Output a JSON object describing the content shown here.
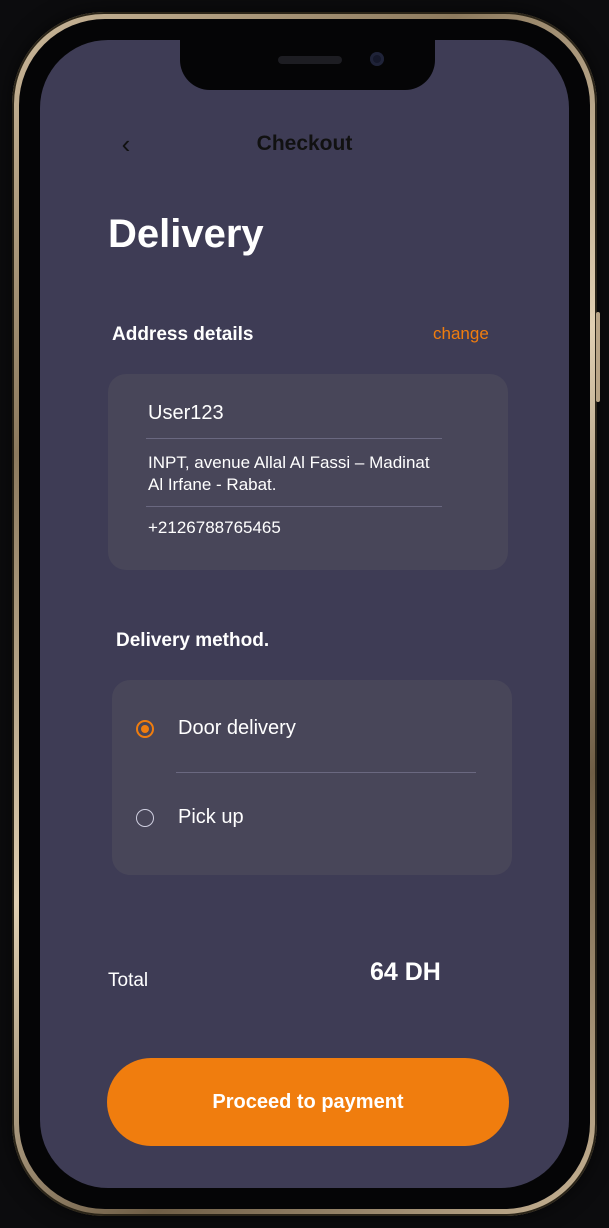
{
  "header": {
    "back_icon": "chevron-left-icon",
    "back_glyph": "‹",
    "title": "Checkout"
  },
  "page": {
    "title": "Delivery"
  },
  "address": {
    "section_label": "Address details",
    "change_label": "change",
    "name": "User123",
    "street": "INPT, avenue Allal Al Fassi – Madinat Al Irfane - Rabat.",
    "phone": "+2126788765465"
  },
  "delivery_method": {
    "section_label": "Delivery method.",
    "options": [
      {
        "label": "Door delivery",
        "selected": true
      },
      {
        "label": "Pick up",
        "selected": false
      }
    ]
  },
  "total": {
    "label": "Total",
    "value": "64 DH"
  },
  "actions": {
    "proceed_label": "Proceed to payment"
  },
  "colors": {
    "accent": "#f07d0e",
    "background": "#3e3c55",
    "card": "#484659"
  }
}
